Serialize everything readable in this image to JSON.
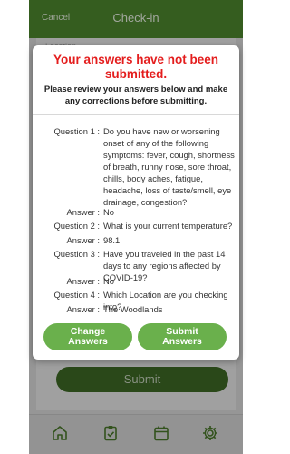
{
  "header": {
    "cancel_label": "Cancel",
    "title": "Check-in"
  },
  "background": {
    "form_hint": "Location",
    "submit_label": "Submit"
  },
  "modal": {
    "title": "Your answers have not been submitted.",
    "subtitle": "Please review your answers below and make any corrections before submitting.",
    "items": [
      {
        "q_label": "Question 1 :",
        "question": "Do you have new or worsening onset of any of the following symptoms: fever, cough, shortness of breath, runny nose, sore throat, chills, body aches, fatigue, headache, loss of taste/smell, eye drainage, congestion?",
        "a_label": "Answer :",
        "answer": "No"
      },
      {
        "q_label": "Question 2 :",
        "question": "What is your current temperature?",
        "a_label": "Answer :",
        "answer": "98.1"
      },
      {
        "q_label": "Question 3 :",
        "question": "Have you traveled in the past 14 days to any regions affected by COVID-19?",
        "a_label": "Answer :",
        "answer": "No"
      },
      {
        "q_label": "Question 4 :",
        "question": "Which Location are you checking into?",
        "a_label": "Answer :",
        "answer": "The Woodlands"
      }
    ],
    "change_label_1": "Change",
    "change_label_2": "Answers",
    "submit_label_1": "Submit",
    "submit_label_2": "Answers"
  },
  "nav": {
    "icons": [
      "home-icon",
      "clipboard-check-icon",
      "calendar-icon",
      "gear-icon"
    ],
    "accent": "#4f8a2e"
  }
}
